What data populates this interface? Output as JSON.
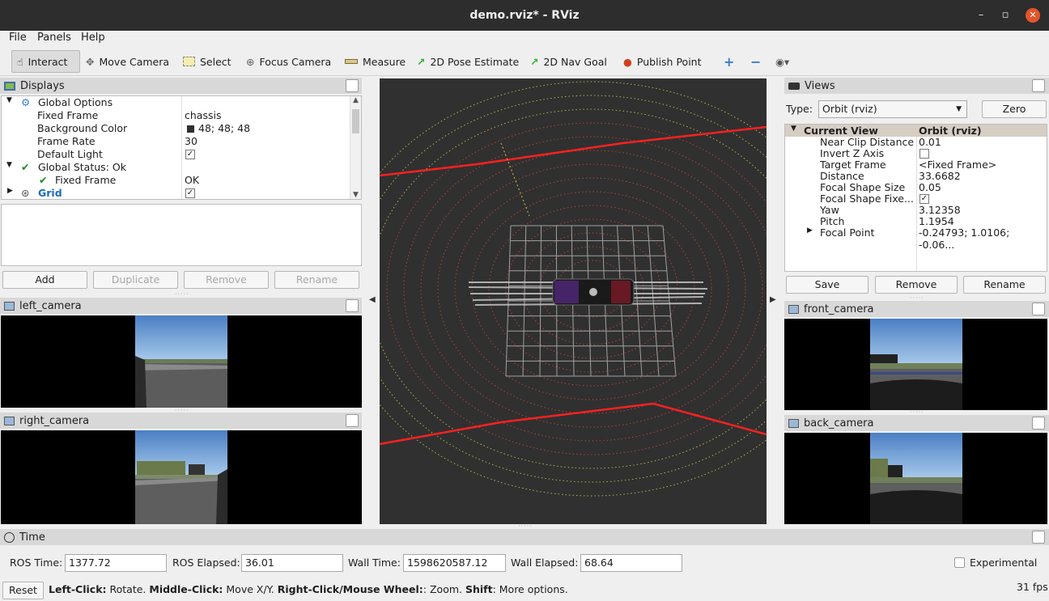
{
  "window": {
    "title": "demo.rviz* - RViz",
    "minimize": "–",
    "maximize": "▫",
    "close": "✕"
  },
  "menu": [
    "File",
    "Panels",
    "Help"
  ],
  "toolbar": {
    "interact": "Interact",
    "move_camera": "Move Camera",
    "select": "Select",
    "focus_camera": "Focus Camera",
    "measure": "Measure",
    "pose_estimate": "2D Pose Estimate",
    "nav_goal": "2D Nav Goal",
    "publish_point": "Publish Point"
  },
  "displays": {
    "title": "Displays",
    "rows": [
      {
        "key": "Global Options",
        "value": ""
      },
      {
        "key": "Fixed Frame",
        "value": "chassis"
      },
      {
        "key": "Background Color",
        "value": "48; 48; 48"
      },
      {
        "key": "Frame Rate",
        "value": "30"
      },
      {
        "key": "Default Light",
        "value": "✓"
      },
      {
        "key": "Global Status: Ok",
        "value": ""
      },
      {
        "key": "Fixed Frame",
        "value": "OK"
      },
      {
        "key": "Grid",
        "value": "✓"
      }
    ],
    "buttons": {
      "add": "Add",
      "duplicate": "Duplicate",
      "remove": "Remove",
      "rename": "Rename"
    }
  },
  "cameras": {
    "left": "left_camera",
    "right": "right_camera",
    "front": "front_camera",
    "back": "back_camera"
  },
  "views": {
    "title": "Views",
    "type_label": "Type:",
    "type_value": "Orbit (rviz)",
    "zero": "Zero",
    "header_key": "Current View",
    "header_value": "Orbit (rviz)",
    "rows": [
      {
        "key": "Near Clip Distance",
        "value": "0.01"
      },
      {
        "key": "Invert Z Axis",
        "value": ""
      },
      {
        "key": "Target Frame",
        "value": "<Fixed Frame>"
      },
      {
        "key": "Distance",
        "value": "33.6682"
      },
      {
        "key": "Focal Shape Size",
        "value": "0.05"
      },
      {
        "key": "Focal Shape Fixe...",
        "value": "✓"
      },
      {
        "key": "Yaw",
        "value": "3.12358"
      },
      {
        "key": "Pitch",
        "value": "1.1954"
      },
      {
        "key": "Focal Point",
        "value": "-0.24793; 1.0106; -0.06..."
      }
    ],
    "buttons": {
      "save": "Save",
      "remove": "Remove",
      "rename": "Rename"
    }
  },
  "time": {
    "title": "Time",
    "ros_time_label": "ROS Time:",
    "ros_time": "1377.72",
    "ros_elapsed_label": "ROS Elapsed:",
    "ros_elapsed": "36.01",
    "wall_time_label": "Wall Time:",
    "wall_time": "1598620587.12",
    "wall_elapsed_label": "Wall Elapsed:",
    "wall_elapsed": "68.64",
    "experimental": "Experimental"
  },
  "status": {
    "reset": "Reset",
    "b1": "Left-Click:",
    "t1": " Rotate. ",
    "b2": "Middle-Click:",
    "t2": " Move X/Y. ",
    "b3": "Right-Click/Mouse Wheel:",
    "t3": ": Zoom. ",
    "b4": "Shift",
    "t4": ": More options.",
    "fps": "31 fps"
  },
  "colors": {
    "viewport_bg": "#303030",
    "status_ok": "#1d8a1d",
    "grid_blue": "#1c6bc0"
  }
}
